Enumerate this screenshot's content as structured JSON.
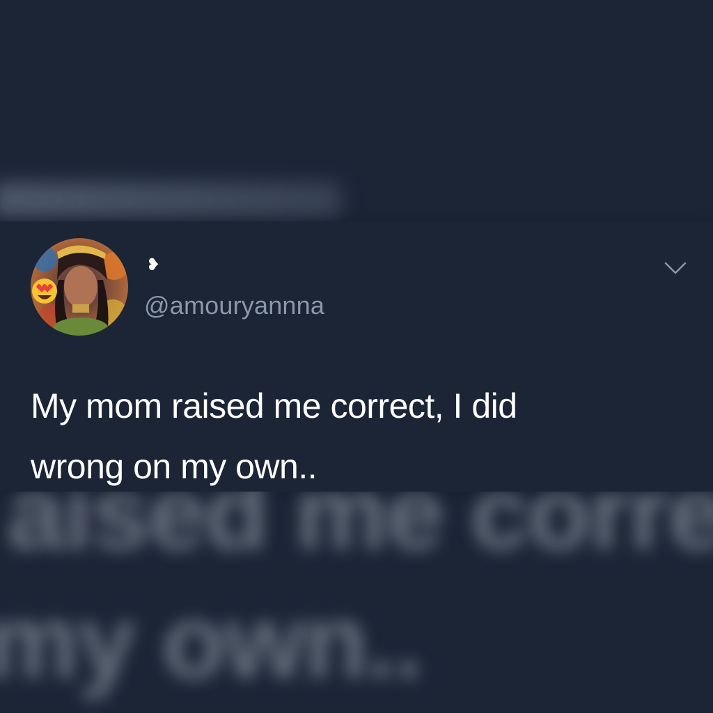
{
  "tweet": {
    "display_name_glyph": "❥",
    "handle": "@amouryannna",
    "text_lines": [
      "My mom raised me correct, I did",
      "wrong on my own.."
    ],
    "avatar_emoji_icon": "heart-eyes-emoji-icon",
    "menu_icon": "chevron-down-icon"
  },
  "background": {
    "blurred_text_1": "aised me correc",
    "blurred_text_2": "my own.."
  },
  "colors": {
    "background": "#1b2536",
    "text": "#ffffff",
    "handle": "#8b98a8"
  }
}
